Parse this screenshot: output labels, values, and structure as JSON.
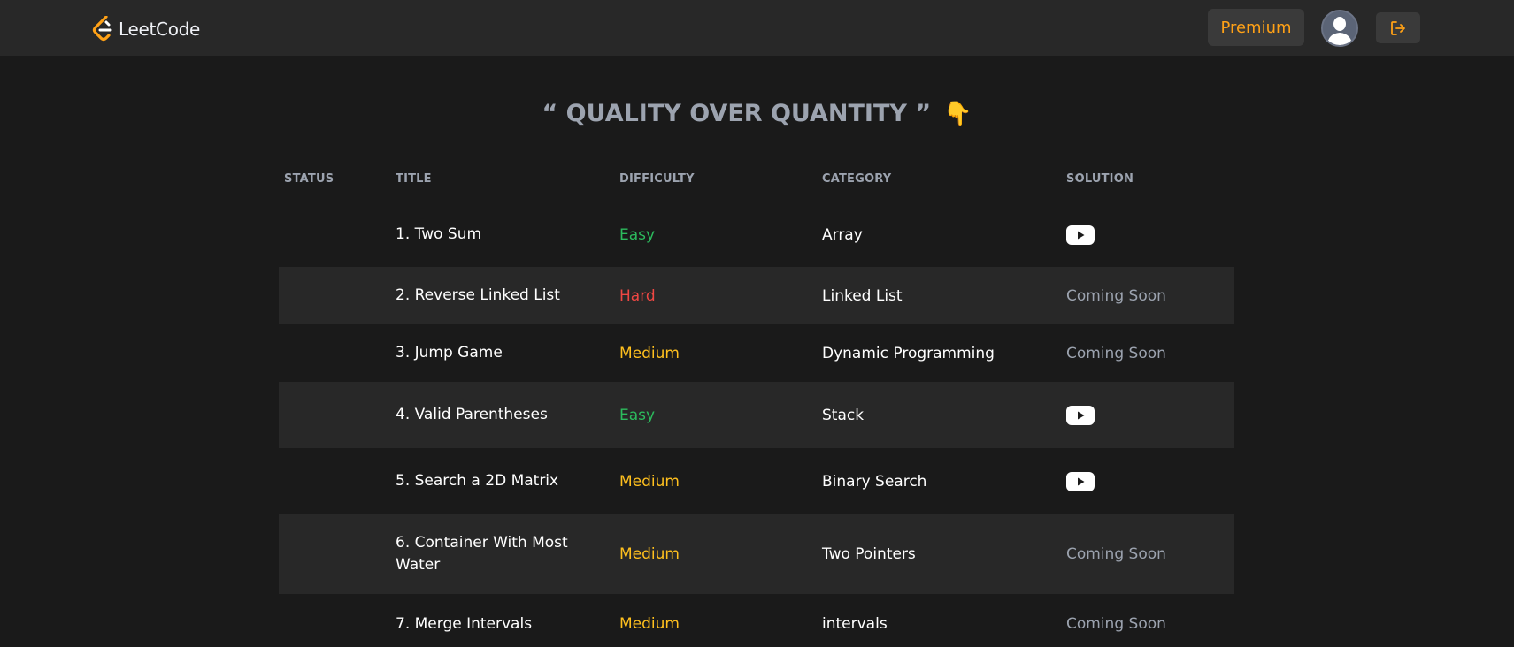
{
  "header": {
    "logo_text": "LeetCode",
    "premium_label": "Premium",
    "accent": "#ffa116"
  },
  "quote": {
    "text": "“ QUALITY OVER QUANTITY ”",
    "emoji": "👇"
  },
  "table": {
    "columns": [
      "STATUS",
      "TITLE",
      "DIFFICULTY",
      "CATEGORY",
      "SOLUTION"
    ],
    "rows": [
      {
        "status": "",
        "title": "1. Two Sum",
        "difficulty": "Easy",
        "category": "Array",
        "solution": "youtube-icon"
      },
      {
        "status": "",
        "title": "2. Reverse Linked List",
        "difficulty": "Hard",
        "category": "Linked List",
        "solution": "Coming Soon"
      },
      {
        "status": "",
        "title": "3. Jump Game",
        "difficulty": "Medium",
        "category": "Dynamic Programming",
        "solution": "Coming Soon"
      },
      {
        "status": "",
        "title": "4. Valid Parentheses",
        "difficulty": "Easy",
        "category": "Stack",
        "solution": "youtube-icon"
      },
      {
        "status": "",
        "title": "5. Search a 2D Matrix",
        "difficulty": "Medium",
        "category": "Binary Search",
        "solution": "youtube-icon"
      },
      {
        "status": "",
        "title": "6. Container With Most Water",
        "difficulty": "Medium",
        "category": "Two Pointers",
        "solution": "Coming Soon"
      },
      {
        "status": "",
        "title": "7. Merge Intervals",
        "difficulty": "Medium",
        "category": "intervals",
        "solution": "Coming Soon"
      }
    ]
  },
  "colors": {
    "easy": "#2cbb5d",
    "medium": "#ffc01e",
    "hard": "#ef4743",
    "background": "#1a1a1a",
    "row_alt": "#282828"
  }
}
